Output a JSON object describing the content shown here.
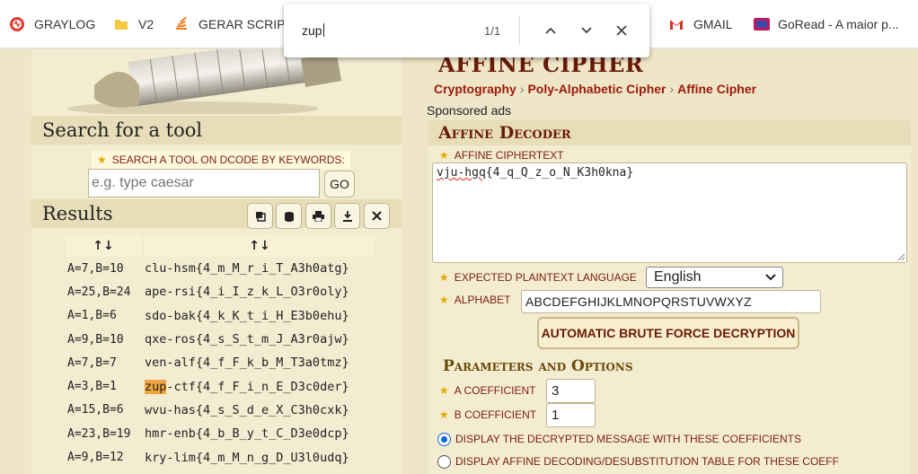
{
  "bookmarks": [
    {
      "label": "GRAYLOG",
      "icon": "graylog-icon"
    },
    {
      "label": "V2",
      "icon": "folder-icon"
    },
    {
      "label": "GERAR SCRIPT",
      "icon": "stack-icon"
    },
    {
      "label": "GMAIL",
      "icon": "gmail-icon"
    },
    {
      "label": "GoRead - A maior p...",
      "icon": "goread-icon"
    }
  ],
  "find": {
    "query": "zup",
    "count": "1/1"
  },
  "left": {
    "search_heading": "Search for a tool",
    "search_label": "SEARCH A TOOL ON DCODE BY KEYWORDS:",
    "search_placeholder": "e.g. type caesar",
    "go_label": "GO",
    "results_heading": "Results",
    "table_headers": [
      "↑↓",
      "↑↓"
    ],
    "results": [
      {
        "key": "A=7,B=10",
        "pre": "",
        "hl": "",
        "text": "clu-hsm{4_m_M_r_i_T_A3h0atg}"
      },
      {
        "key": "A=25,B=24",
        "pre": "",
        "hl": "",
        "text": "ape-rsi{4_i_I_z_k_L_O3r0oly}"
      },
      {
        "key": "A=1,B=6",
        "pre": "",
        "hl": "",
        "text": "sdo-bak{4_k_K_t_i_H_E3b0ehu}"
      },
      {
        "key": "A=9,B=10",
        "pre": "",
        "hl": "",
        "text": "qxe-ros{4_s_S_t_m_J_A3r0ajw}"
      },
      {
        "key": "A=7,B=7",
        "pre": "",
        "hl": "",
        "text": "ven-alf{4_f_F_k_b_M_T3a0tmz}"
      },
      {
        "key": "A=3,B=1",
        "pre": "",
        "hl": "zup",
        "text": "-ctf{4_f_F_i_n_E_D3c0der}"
      },
      {
        "key": "A=15,B=6",
        "pre": "",
        "hl": "",
        "text": "wvu-has{4_s_S_d_e_X_C3h0cxk}"
      },
      {
        "key": "A=23,B=19",
        "pre": "",
        "hl": "",
        "text": "hmr-enb{4_b_B_y_t_C_D3e0dcp}"
      },
      {
        "key": "A=9,B=12",
        "pre": "",
        "hl": "",
        "text": "kry-lim{4_m_M_n_g_D_U3l0udq}"
      }
    ]
  },
  "right": {
    "title": "AFFINE CIPHER",
    "breadcrumbs": [
      "Cryptography",
      "Poly-Alphabetic Cipher",
      "Affine Cipher"
    ],
    "sponsored": "Sponsored ads",
    "decoder_heading": "Affine Decoder",
    "ciphertext_label": "AFFINE CIPHERTEXT",
    "ciphertext_underlined": "vju-hgq",
    "ciphertext_rest": "{4_q_Q_z_o_N_K3h0kna}",
    "language_label": "EXPECTED PLAINTEXT LANGUAGE",
    "language_value": "English",
    "alphabet_label": "ALPHABET",
    "alphabet_value": "ABCDEFGHIJKLMNOPQRSTUVWXYZ",
    "brute_label": "AUTOMATIC BRUTE FORCE DECRYPTION",
    "params_heading": "Parameters and Options",
    "a_label": "A COEFFICIENT",
    "a_value": "3",
    "b_label": "B COEFFICIENT",
    "b_value": "1",
    "radio1_label": "DISPLAY THE DECRYPTED MESSAGE WITH THESE COEFFICIENTS",
    "radio2_label": "DISPLAY AFFINE DECODING/DESUBSTITUTION TABLE FOR THESE COEFF"
  },
  "colors": {
    "accent": "#6b1a08",
    "link": "#9b1a0a",
    "highlight": "#f2a43f",
    "panel": "#f3ecd1",
    "header": "#e7ddb8"
  }
}
